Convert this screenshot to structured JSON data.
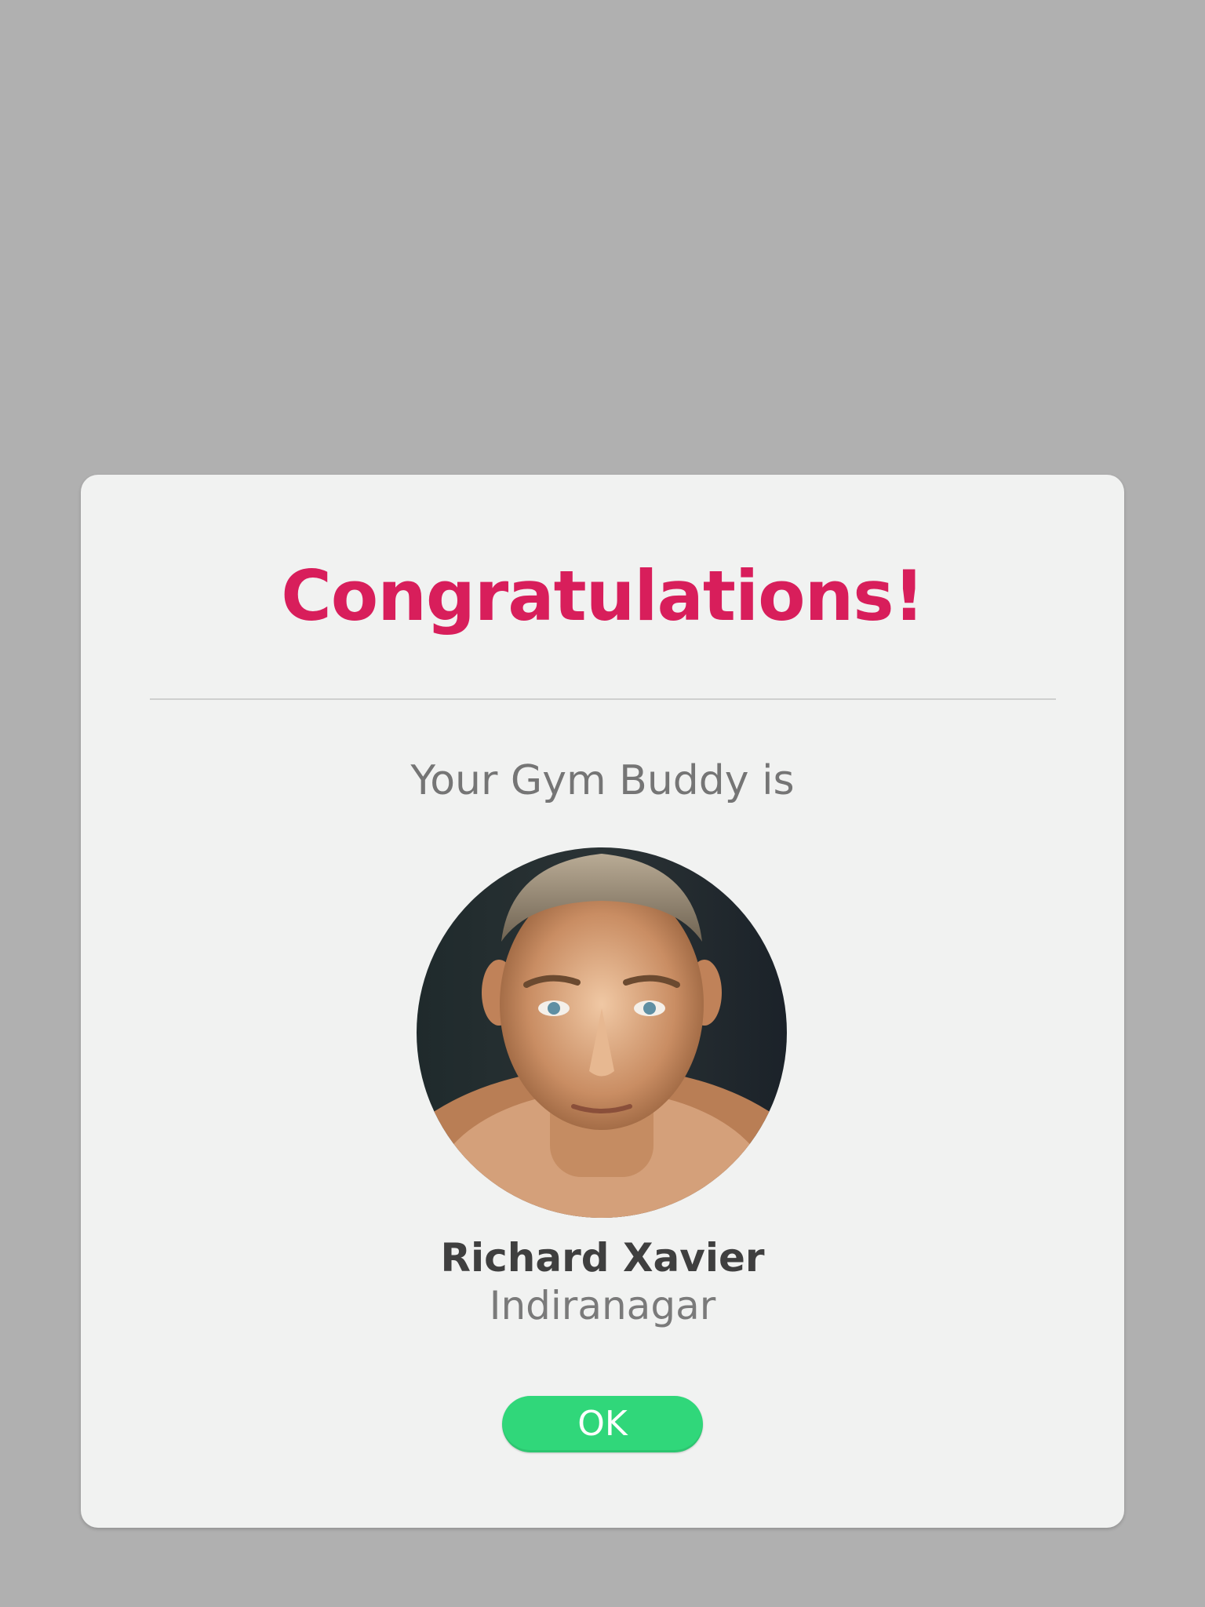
{
  "modal": {
    "title": "Congratulations!",
    "subtitle": "Your Gym Buddy is",
    "buddy": {
      "name": "Richard Xavier",
      "location": "Indiranagar",
      "avatar_icon": "buddy-avatar-photo"
    },
    "ok_label": "OK"
  },
  "colors": {
    "overlay": "#b0b0b0",
    "modal_background": "#f1f2f1",
    "title": "#d81e5b",
    "button": "#30d77a"
  }
}
